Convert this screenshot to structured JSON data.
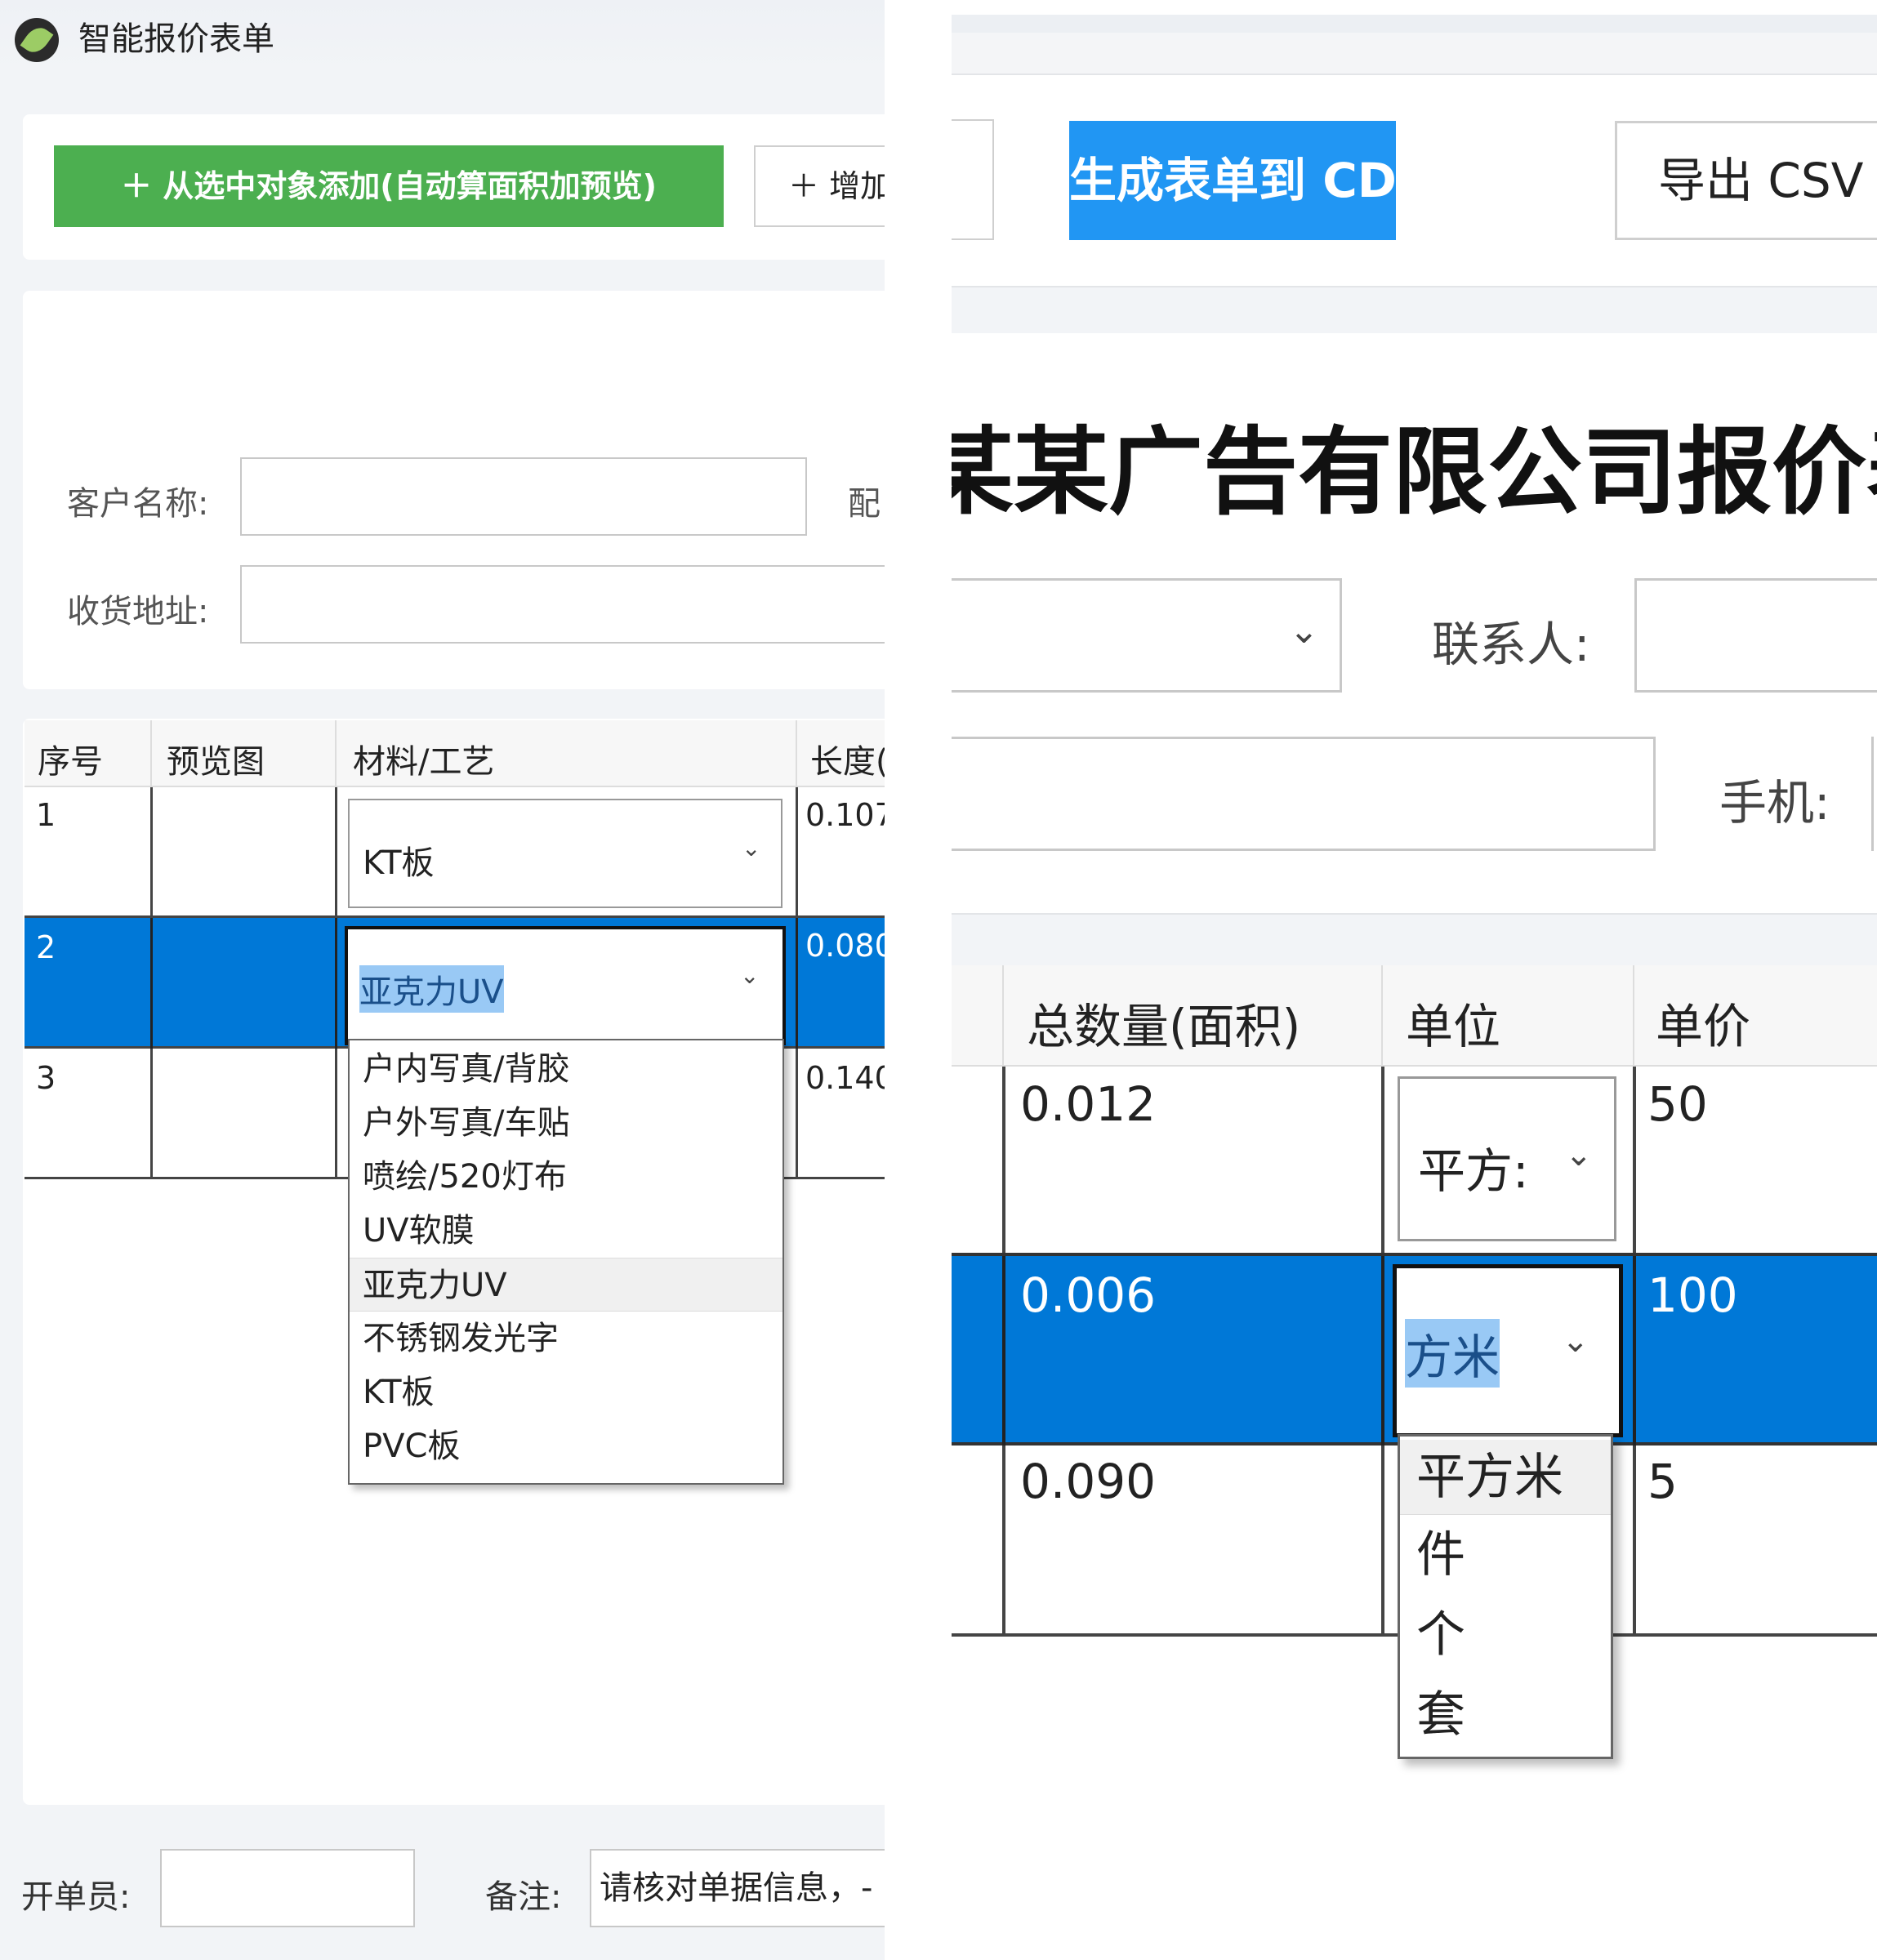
{
  "window": {
    "title": "智能报价表单",
    "app_icon": "quill-logo-icon"
  },
  "toolbar": {
    "add_from_selection": "＋ 从选中对象添加(自动算面积加预览)",
    "add_row_partial": "＋ 增加",
    "generate_cdr": "生成表单到 CDR",
    "export_csv_partial": "导出 CSV"
  },
  "form": {
    "customer_label": "客户名称:",
    "customer_value": "",
    "delivery_label_partial": "配",
    "address_label": "收货地址:",
    "address_value": "",
    "company_title_partial": "某某广告有限公司报价表",
    "contact_label": "联系人:",
    "contact_value": "",
    "phone_label": "手机:"
  },
  "table": {
    "headers": [
      "序号",
      "预览图",
      "材料/工艺",
      "长度("
    ],
    "headers_right": [
      "总数量(面积)",
      "单位",
      "单价"
    ],
    "rows": [
      {
        "index": "1",
        "material": "KT板",
        "length": "0.107",
        "total": "0.012",
        "unit": "平方米",
        "unit_shown": "平方:",
        "price": "50"
      },
      {
        "index": "2",
        "material": "亚克力UV",
        "length": "0.080",
        "total": "0.006",
        "unit": "平方米",
        "unit_shown": "方米",
        "price": "100"
      },
      {
        "index": "3",
        "material": "",
        "length": "0.140",
        "total": "0.090",
        "unit": "",
        "unit_shown": "",
        "price": "5"
      }
    ],
    "selected_row": 2
  },
  "material_dropdown": {
    "options": [
      "户内写真/背胶",
      "户外写真/车贴",
      "喷绘/520灯布",
      "UV软膜",
      "亚克力UV",
      "不锈钢发光字",
      "KT板",
      "PVC板"
    ],
    "highlighted": "亚克力UV"
  },
  "unit_dropdown": {
    "options": [
      "平方米",
      "件",
      "个",
      "套"
    ],
    "highlighted": "平方米"
  },
  "footer": {
    "operator_label": "开单员:",
    "operator_value": "",
    "remark_label": "备注:",
    "remark_value": "请核对单据信息，-"
  },
  "colors": {
    "green_button": "#4caf50",
    "blue_button": "#2196f3",
    "selection_blue": "#0078d7",
    "text_highlight": "#99c9f5"
  }
}
